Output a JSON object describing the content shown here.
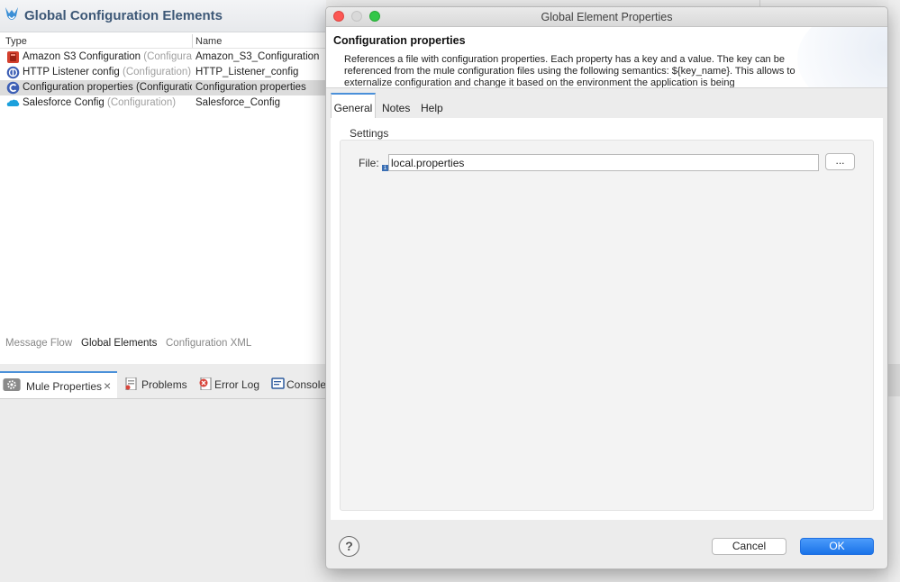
{
  "editor": {
    "title": "Global Configuration Elements",
    "columns": {
      "type": "Type",
      "name": "Name"
    },
    "rows": [
      {
        "type": "Amazon S3 Configuration",
        "kind": "(Configuration)",
        "name": "Amazon_S3_Configuration",
        "icon": "amazon-s3-icon",
        "selected": false
      },
      {
        "type": "HTTP Listener config",
        "kind": "(Configuration)",
        "name": "HTTP_Listener_config",
        "icon": "http-listener-icon",
        "selected": false
      },
      {
        "type": "Configuration properties",
        "kind": "(Configuration)",
        "name": "Configuration properties",
        "icon": "configuration-properties-icon",
        "selected": true
      },
      {
        "type": "Salesforce Config",
        "kind": "(Configuration)",
        "name": "Salesforce_Config",
        "icon": "salesforce-cloud-icon",
        "selected": false
      }
    ],
    "bottom_tabs": [
      "Message Flow",
      "Global Elements",
      "Configuration XML"
    ]
  },
  "views": {
    "tabs": [
      {
        "label": "Mule Properties",
        "icon": "gear-icon"
      },
      {
        "label": "Problems",
        "icon": "problems-icon"
      },
      {
        "label": "Error Log",
        "icon": "error-log-icon"
      },
      {
        "label": "Console",
        "icon": "console-icon"
      }
    ]
  },
  "dialog": {
    "title": "Global Element Properties",
    "heading": "Configuration properties",
    "description": "References a file with configuration properties. Each property has a key and a value. The key can be referenced from the mule configuration files using the following semantics: ${key_name}. This allows to externalize configuration and change it based on the environment the application is being",
    "tabs": [
      "General",
      "Notes",
      "Help"
    ],
    "settings_label": "Settings",
    "file_label": "File:",
    "file_value": "local.properties",
    "browse_label": "...",
    "help_label": "?",
    "cancel_label": "Cancel",
    "ok_label": "OK"
  },
  "colors": {
    "accent": "#1a73e8",
    "title_blue": "#3d5877",
    "selected_row": "#dcdcdc"
  }
}
